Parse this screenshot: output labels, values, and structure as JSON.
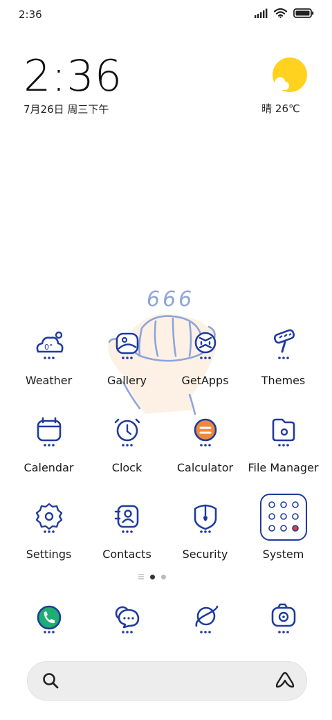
{
  "status_bar": {
    "time": "2:36"
  },
  "clock_widget": {
    "time": "2:36",
    "date": "7月26日 周三下午"
  },
  "weather_widget": {
    "text": "晴 26℃"
  },
  "sticker": {
    "text": "666"
  },
  "apps": [
    {
      "label": "Weather",
      "icon": "weather-icon",
      "badge": "0°"
    },
    {
      "label": "Gallery",
      "icon": "gallery-icon"
    },
    {
      "label": "GetApps",
      "icon": "getapps-icon"
    },
    {
      "label": "Themes",
      "icon": "themes-icon"
    },
    {
      "label": "Calendar",
      "icon": "calendar-icon"
    },
    {
      "label": "Clock",
      "icon": "clock-icon"
    },
    {
      "label": "Calculator",
      "icon": "calculator-icon"
    },
    {
      "label": "File Manager",
      "icon": "file-manager-icon"
    },
    {
      "label": "Settings",
      "icon": "settings-icon"
    },
    {
      "label": "Contacts",
      "icon": "contacts-icon"
    },
    {
      "label": "Security",
      "icon": "security-icon"
    },
    {
      "label": "System",
      "icon": "system-folder-icon"
    }
  ],
  "dock": [
    {
      "icon": "phone-icon"
    },
    {
      "icon": "messages-icon"
    },
    {
      "icon": "browser-icon"
    },
    {
      "icon": "camera-icon"
    }
  ],
  "colors": {
    "icon_stroke": "#1f3b9c",
    "sticker_line": "#8ea4dc",
    "calculator_accent": "#f0883a",
    "phone_accent": "#1fae72",
    "weather_sun": "#ffd21f"
  }
}
